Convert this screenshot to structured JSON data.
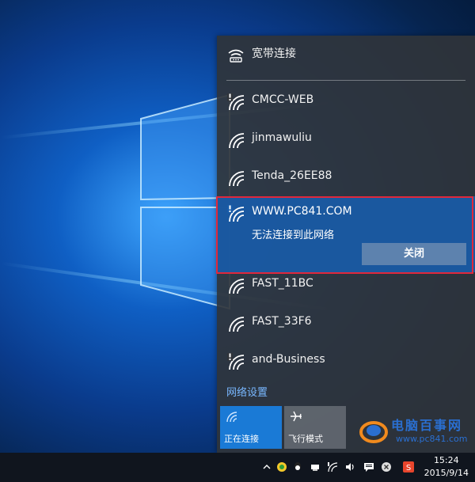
{
  "flyout": {
    "broadband": {
      "label": "宽带连接",
      "icon": "dialup-icon"
    },
    "networks": [
      {
        "ssid": "CMCC-WEB",
        "secured": false
      },
      {
        "ssid": "jinmawuliu",
        "secured": true
      },
      {
        "ssid": "Tenda_26EE88",
        "secured": true
      },
      {
        "ssid": "WWW.PC841.COM",
        "secured": false,
        "selected": true,
        "status": "无法连接到此网络",
        "button": "关闭"
      },
      {
        "ssid": "FAST_11BC",
        "secured": true
      },
      {
        "ssid": "FAST_33F6",
        "secured": true
      },
      {
        "ssid": "and-Business",
        "secured": false
      }
    ],
    "settings_link": "网络设置",
    "tiles": [
      {
        "label": "正在连接",
        "icon": "wifi-icon",
        "active": true
      },
      {
        "label": "飞行模式",
        "icon": "airplane-icon",
        "active": false
      }
    ]
  },
  "taskbar": {
    "time": "15:24",
    "date": "2015/9/14"
  },
  "watermark": {
    "title": "电脑百事网",
    "url": "www.pc841.com"
  },
  "colors": {
    "selected_bg": "#185caa",
    "highlight_border": "#e0283c",
    "link": "#79b7ff",
    "active_tile": "#1a7ad6"
  }
}
